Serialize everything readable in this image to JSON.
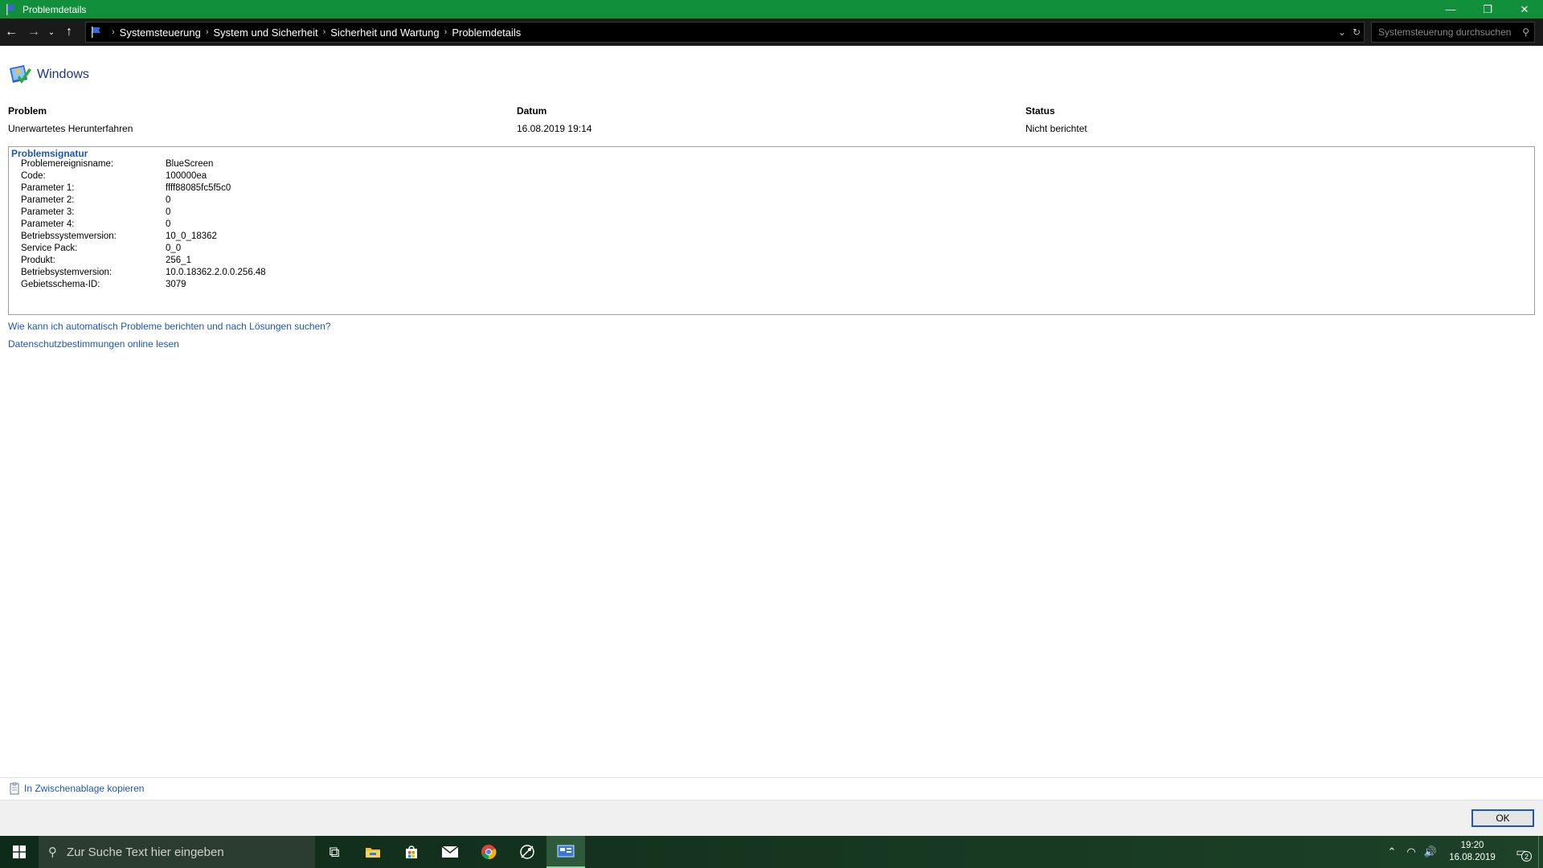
{
  "window": {
    "title": "Problemdetails",
    "minimize_glyph": "—",
    "restore_glyph": "❐",
    "close_glyph": "✕"
  },
  "nav": {
    "back_glyph": "←",
    "forward_glyph": "→",
    "recent_glyph": "⌄",
    "up_glyph": "↑",
    "breadcrumbs": [
      "Systemsteuerung",
      "System und Sicherheit",
      "Sicherheit und Wartung",
      "Problemdetails"
    ],
    "separator": "›",
    "dropdown_glyph": "⌄",
    "refresh_glyph": "↻",
    "search_placeholder": "Systemsteuerung durchsuchen"
  },
  "brand": {
    "name": "Windows"
  },
  "summary": {
    "headers": [
      "Problem",
      "Datum",
      "Status"
    ],
    "values": [
      "Unerwartetes Herunterfahren",
      "16.08.2019 19:14",
      "Nicht berichtet"
    ]
  },
  "signature": {
    "title": "Problemsignatur",
    "rows": [
      {
        "k": "Problemereignisname:",
        "v": "BlueScreen"
      },
      {
        "k": "Code:",
        "v": "100000ea"
      },
      {
        "k": "Parameter 1:",
        "v": "ffff88085fc5f5c0"
      },
      {
        "k": "Parameter 2:",
        "v": "0"
      },
      {
        "k": "Parameter 3:",
        "v": "0"
      },
      {
        "k": "Parameter 4:",
        "v": "0"
      },
      {
        "k": "Betriebssystemversion:",
        "v": "10_0_18362"
      },
      {
        "k": "Service Pack:",
        "v": "0_0"
      },
      {
        "k": "Produkt:",
        "v": "256_1"
      },
      {
        "k": "Betriebsystemversion:",
        "v": "10.0.18362.2.0.0.256.48"
      },
      {
        "k": "Gebietsschema-ID:",
        "v": "3079"
      }
    ]
  },
  "links": {
    "auto_report": "Wie kann ich automatisch Probleme berichten und nach Lösungen suchen?",
    "privacy": "Datenschutzbestimmungen online lesen",
    "copy": "In Zwischenablage kopieren"
  },
  "buttons": {
    "ok": "OK"
  },
  "taskbar": {
    "search_placeholder": "Zur Suche Text hier eingeben",
    "search_glyph": "⚲",
    "task_view_glyph": "⧉",
    "tray_up_glyph": "⌃",
    "network_glyph": "◠",
    "volume_glyph": "🔊",
    "time": "19:20",
    "date": "16.08.2019",
    "notification_glyph": "▭",
    "notification_count": "2"
  },
  "colors": {
    "titlebar": "#128f3a",
    "link": "#1e56b4",
    "brand": "#1e3287",
    "taskbar": "#14331e"
  }
}
